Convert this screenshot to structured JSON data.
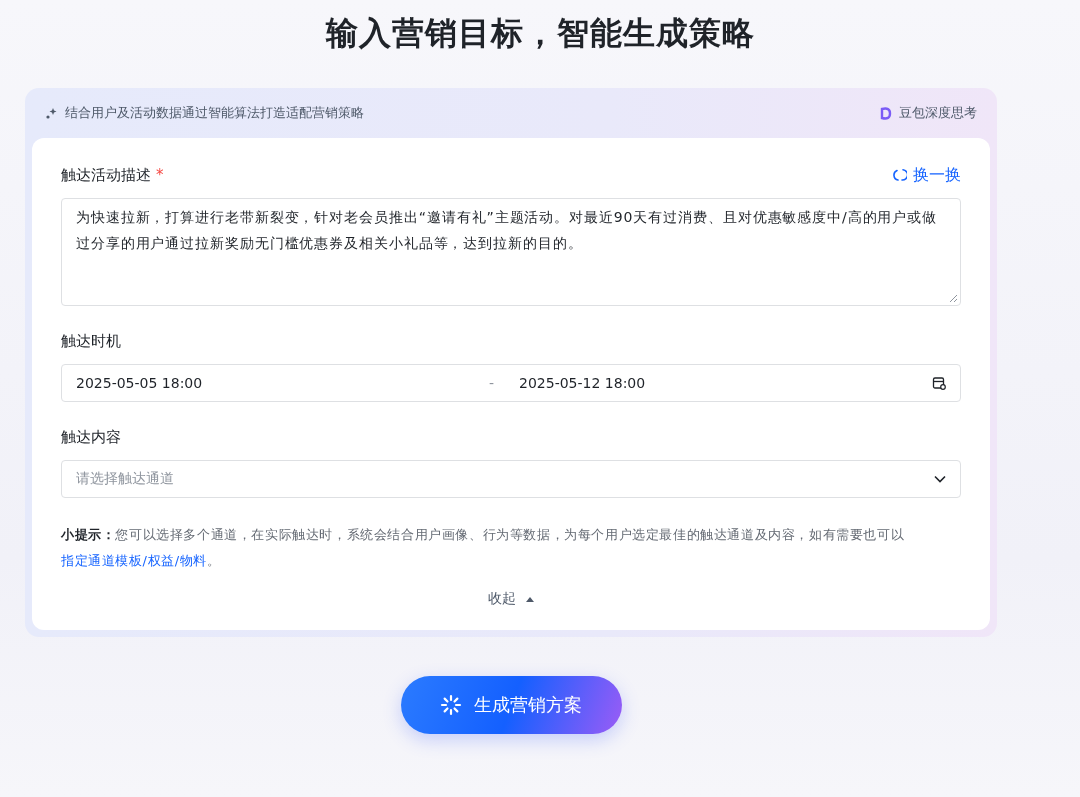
{
  "title": "输入营销目标，智能生成策略",
  "panel": {
    "subtitle": "结合用户及活动数据通过智能算法打造适配营销策略",
    "model": "豆包深度思考"
  },
  "description": {
    "label": "触达活动描述",
    "required_mark": "*",
    "refresh": "换一换",
    "value": "为快速拉新，打算进行老带新裂变，针对老会员推出“邀请有礼”主题活动。对最近90天有过消费、且对优惠敏感度中/高的用户或做过分享的用户通过拉新奖励无门槛优惠券及相关小礼品等，达到拉新的目的。"
  },
  "timing": {
    "label": "触达时机",
    "start": "2025-05-05 18:00",
    "separator": "-",
    "end": "2025-05-12 18:00"
  },
  "content": {
    "label": "触达内容",
    "placeholder": "请选择触达通道"
  },
  "hint": {
    "lead": "小提示：",
    "text": "您可以选择多个通道，在实际触达时，系统会结合用户画像、行为等数据，为每个用户选定最佳的触达通道及内容，如有需要也可以",
    "link": "指定通道模板/权益/物料",
    "tail": "。"
  },
  "collapse": {
    "label": "收起",
    "expanded": true
  },
  "generate_button": "生成营销方案"
}
